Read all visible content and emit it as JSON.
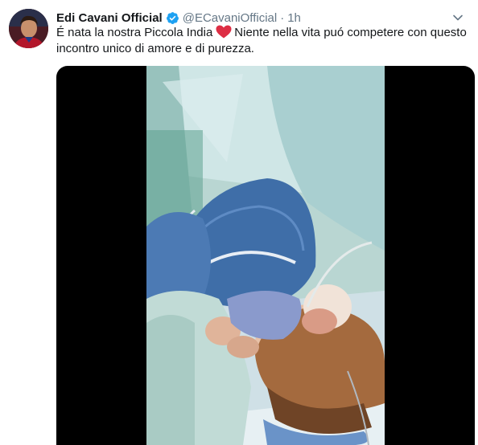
{
  "tweet": {
    "author": {
      "display_name": "Edi Cavani Official",
      "verified_icon": "verified-badge-icon",
      "handle": "@ECavaniOfficial"
    },
    "separator": "·",
    "timestamp": "1h",
    "menu_icon": "chevron-down-icon",
    "text_part1": "É nata la nostra Piccola India",
    "emoji_icon": "red-heart-icon",
    "text_part2": "Niente nella vita puó competere con questo incontro unico di amore e di purezza.",
    "media": {
      "type": "video"
    }
  },
  "colors": {
    "text_primary": "#14171a",
    "text_secondary": "#657786",
    "verified_blue": "#1da1f2",
    "heart_red": "#e0245e",
    "media_background": "#000000"
  }
}
